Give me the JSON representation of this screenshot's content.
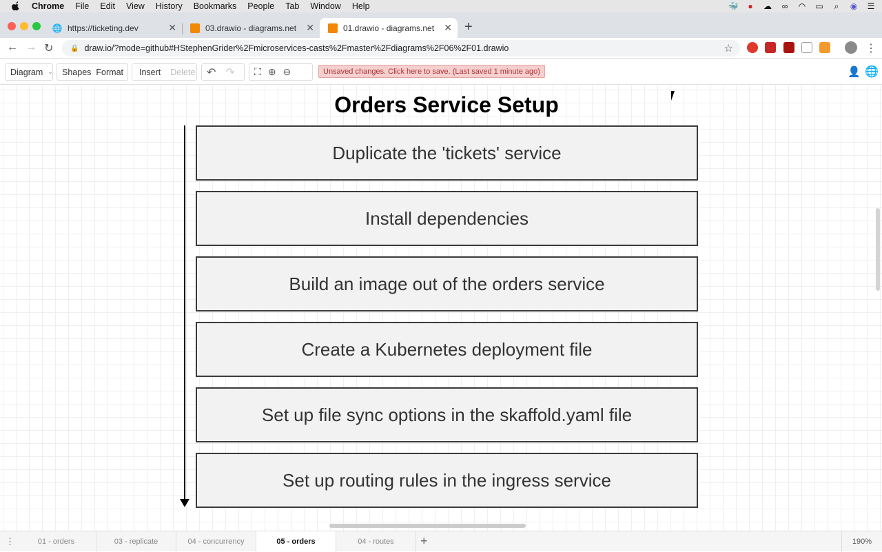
{
  "menubar": {
    "app": "Chrome",
    "items": [
      "File",
      "Edit",
      "View",
      "History",
      "Bookmarks",
      "People",
      "Tab",
      "Window",
      "Help"
    ]
  },
  "browser": {
    "tabs": [
      {
        "title": "https://ticketing.dev",
        "icon": "globe-icon"
      },
      {
        "title": "03.drawio - diagrams.net",
        "icon": "drawio-icon"
      },
      {
        "title": "01.drawio - diagrams.net",
        "icon": "drawio-icon",
        "active": true
      }
    ],
    "url": "draw.io/?mode=github#HStephenGrider%2Fmicroservices-casts%2Fmaster%2Fdiagrams%2F06%2F01.drawio"
  },
  "drawio": {
    "toolbar": {
      "diagram": "Diagram",
      "shapes": "Shapes",
      "format": "Format",
      "insert": "Insert",
      "delete": "Delete"
    },
    "unsaved": "Unsaved changes. Click here to save. (Last saved 1 minute ago)",
    "title": "Orders Service Setup",
    "steps": [
      "Duplicate the 'tickets' service",
      "Install dependencies",
      "Build an image out of the orders service",
      "Create a Kubernetes deployment file",
      "Set up file sync options in the skaffold.yaml file",
      "Set up routing rules in the ingress service"
    ],
    "pages": [
      "01 - orders",
      "03 - replicate",
      "04 - concurrency",
      "05 - orders",
      "04 - routes"
    ],
    "active_page": "05 - orders",
    "zoom": "190%"
  },
  "colors": {
    "accent_unsaved": "#f6cfcf",
    "box_fill": "#f2f2f2"
  }
}
